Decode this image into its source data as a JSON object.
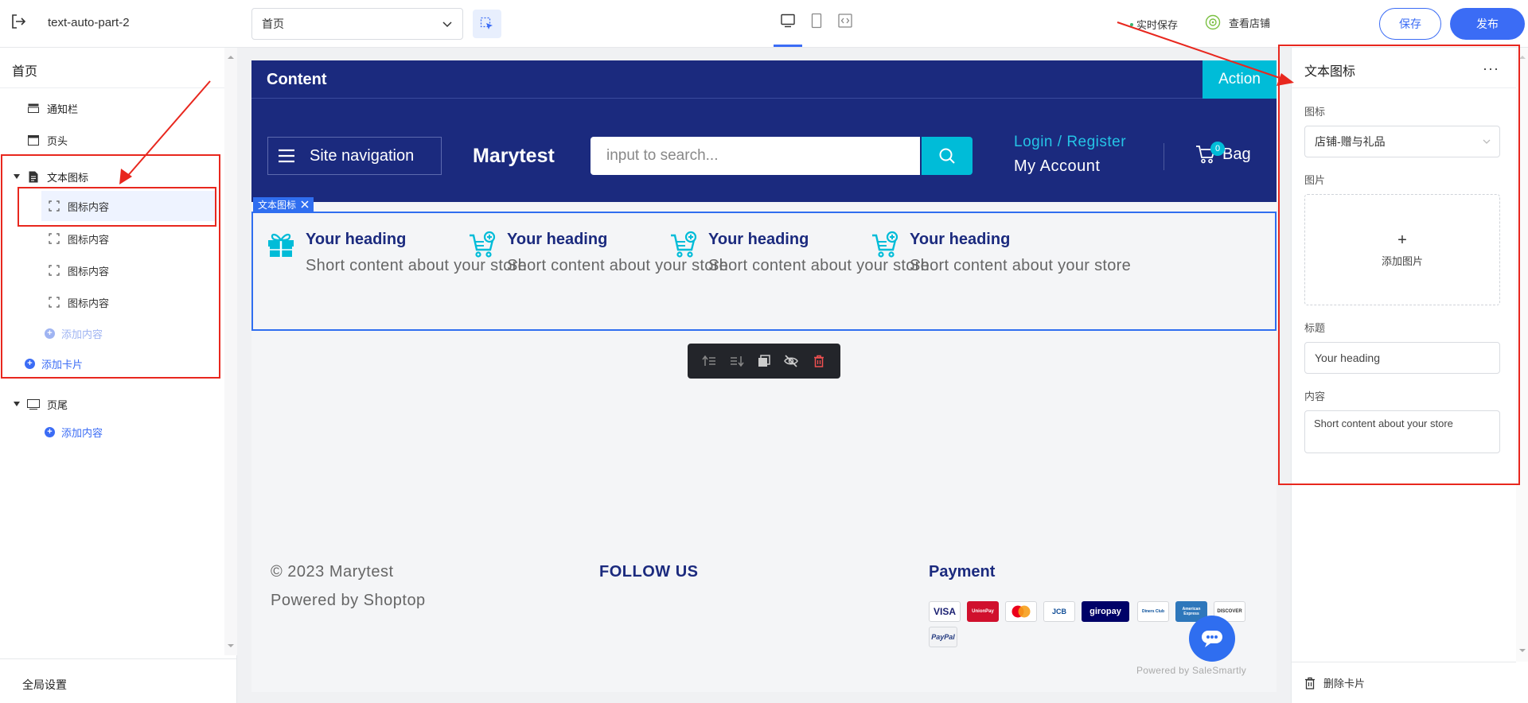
{
  "topbar": {
    "store_name": "text-auto-part-2",
    "page_select": "首页",
    "autosave_label": "实时保存",
    "view_store_label": "查看店铺",
    "save_label": "保存",
    "publish_label": "发布"
  },
  "left_panel": {
    "title": "首页",
    "items": [
      {
        "label": "通知栏",
        "icon": "notice-bar-icon"
      },
      {
        "label": "页头",
        "icon": "header-icon"
      },
      {
        "label": "文本图标",
        "icon": "document-icon"
      }
    ],
    "children": [
      {
        "label": "图标内容"
      },
      {
        "label": "图标内容"
      },
      {
        "label": "图标内容"
      },
      {
        "label": "图标内容"
      }
    ],
    "add_content_label": "添加内容",
    "add_card_label": "添加卡片",
    "footer_label": "页尾",
    "footer_add_content_label": "添加内容",
    "global_settings_label": "全局设置"
  },
  "canvas": {
    "notice": {
      "text": "Content",
      "action": "Action"
    },
    "header": {
      "site_nav": "Site navigation",
      "brand": "Marytest",
      "search_placeholder": "input to search...",
      "login_register": "Login / Register",
      "my_account": "My Account",
      "bag_label": "Bag",
      "bag_count": "0"
    },
    "section_label": "文本图标",
    "text_icons": [
      {
        "heading": "Your heading",
        "content": "Short content about your store",
        "icon": "gift-icon"
      },
      {
        "heading": "Your heading",
        "content": "Short content about your store",
        "icon": "cart-add-icon"
      },
      {
        "heading": "Your heading",
        "content": "Short content about your store",
        "icon": "cart-add-icon"
      },
      {
        "heading": "Your heading",
        "content": "Short content about your store",
        "icon": "cart-add-icon"
      }
    ],
    "footer": {
      "copyright": "© 2023 Marytest",
      "powered": "Powered by Shoptop",
      "follow_us": "FOLLOW US",
      "payment": "Payment",
      "payment_methods": [
        "VISA",
        "UnionPay",
        "Mastercard",
        "JCB",
        "giropay",
        "Diners Club",
        "American Express",
        "DISCOVER",
        "PayPal"
      ],
      "salesmartly": "Powered by SaleSmartly"
    }
  },
  "right_panel": {
    "title": "文本图标",
    "icon_label": "图标",
    "icon_value": "店铺-赠与礼品",
    "image_label": "图片",
    "add_image_label": "添加图片",
    "title_label": "标题",
    "title_value": "Your heading",
    "content_label": "内容",
    "content_value": "Short content about your store",
    "delete_card_label": "删除卡片"
  },
  "colors": {
    "accent": "#3b6cf5",
    "theme_navy": "#1b2a7e",
    "theme_cyan": "#00bcd8",
    "annotation_red": "#e8271e"
  }
}
